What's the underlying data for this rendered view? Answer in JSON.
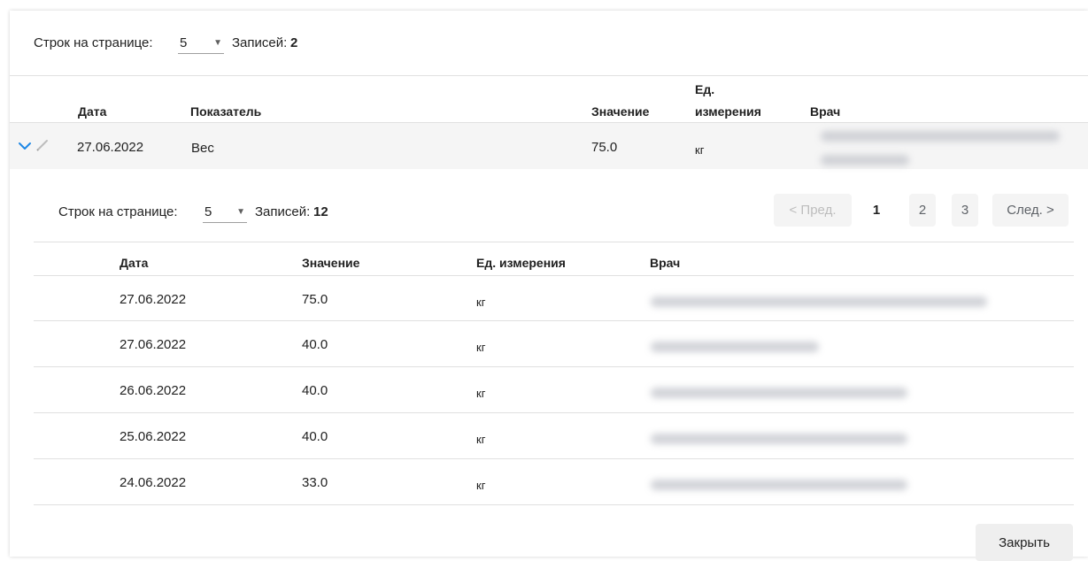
{
  "outer": {
    "rows_per_page_label": "Строк на странице:",
    "rows_per_page_value": "5",
    "records_label": "Записей:",
    "records_count": "2",
    "columns": {
      "date": "Дата",
      "indicator": "Показатель",
      "value": "Значение",
      "unit_line1": "Ед.",
      "unit_line2": "измерения",
      "doctor": "Врач"
    },
    "row": {
      "date": "27.06.2022",
      "indicator": "Вес",
      "value": "75.0",
      "unit": "кг"
    }
  },
  "inner": {
    "rows_per_page_label": "Строк на странице:",
    "rows_per_page_value": "5",
    "records_label": "Записей:",
    "records_count": "12",
    "pagination": {
      "prev": "< Пред.",
      "next": "След. >",
      "pages": [
        "1",
        "2",
        "3"
      ],
      "current_page": "1"
    },
    "columns": {
      "date": "Дата",
      "value": "Значение",
      "unit": "Ед. измерения",
      "doctor": "Врач"
    },
    "rows": [
      {
        "date": "27.06.2022",
        "value": "75.0",
        "unit": "кг"
      },
      {
        "date": "27.06.2022",
        "value": "40.0",
        "unit": "кг"
      },
      {
        "date": "26.06.2022",
        "value": "40.0",
        "unit": "кг"
      },
      {
        "date": "25.06.2022",
        "value": "40.0",
        "unit": "кг"
      },
      {
        "date": "24.06.2022",
        "value": "33.0",
        "unit": "кг"
      }
    ]
  },
  "close_label": "Закрыть",
  "icons": {
    "expand": "chevron-down-icon",
    "edit": "pencil-icon",
    "select_caret": "caret-down-icon"
  },
  "colors": {
    "accent": "#1e88e5",
    "expanded_row_bg": "#f5f5f5",
    "button_bg": "#efefef"
  }
}
